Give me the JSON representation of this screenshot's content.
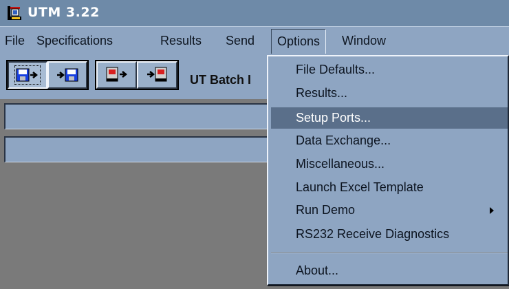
{
  "window": {
    "title": "UTM 3.22"
  },
  "menubar": {
    "items": [
      {
        "label": "File"
      },
      {
        "label": "Specifications"
      },
      {
        "label": "Results"
      },
      {
        "label": "Send"
      },
      {
        "label": "Options"
      },
      {
        "label": "Window"
      }
    ],
    "active": "Options"
  },
  "toolbar": {
    "buttons": [
      {
        "icon": "save-to-disk-icon",
        "pressed": true
      },
      {
        "icon": "load-from-disk-icon",
        "pressed": false
      },
      {
        "icon": "send-to-device-icon",
        "pressed": false
      },
      {
        "icon": "receive-from-device-icon",
        "pressed": false
      }
    ],
    "label": "UT Batch I"
  },
  "options_menu": {
    "items": [
      {
        "label": "File Defaults..."
      },
      {
        "label": "Results..."
      },
      {
        "label": "Setup Ports...",
        "highlighted": true
      },
      {
        "label": "Data Exchange..."
      },
      {
        "label": "Miscellaneous..."
      },
      {
        "label": "Launch Excel Template"
      },
      {
        "label": "Run Demo",
        "submenu": true
      },
      {
        "label": "RS232 Receive Diagnostics"
      },
      {
        "label": "About..."
      }
    ]
  },
  "colors": {
    "titlebar": "#6e8aa8",
    "menu_background": "#8ea5c2",
    "highlight": "#5a6f8a",
    "workspace": "#7a7a7a"
  }
}
